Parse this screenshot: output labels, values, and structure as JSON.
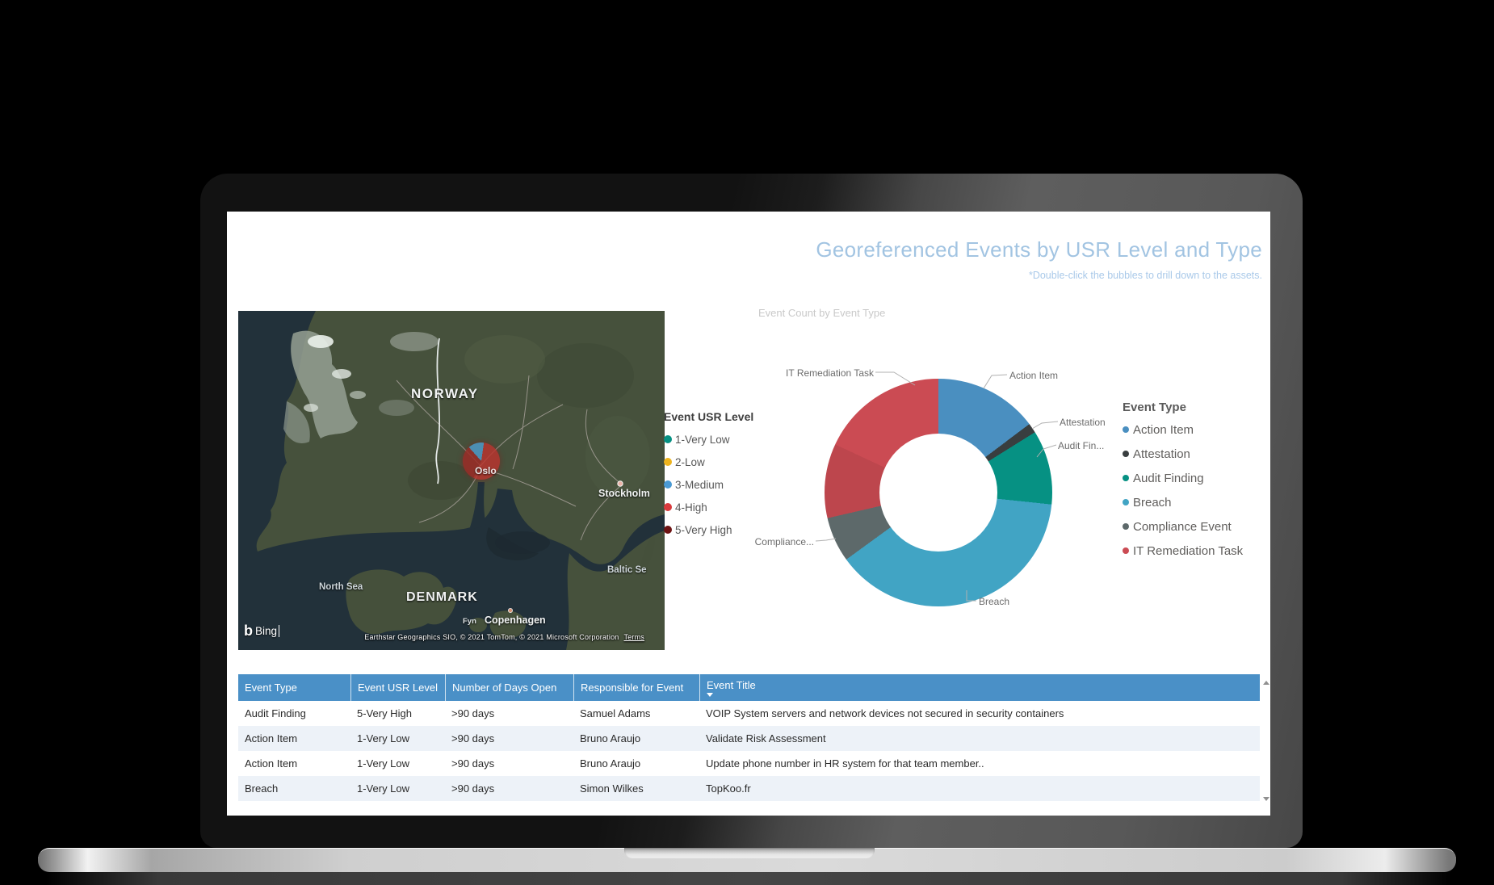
{
  "header": {
    "title": "Georeferenced Events by USR Level and Type",
    "subtitle": "*Double-click the bubbles to drill down to the assets.",
    "title_color": "#a2c4e2"
  },
  "map": {
    "logo": "Bing",
    "logo_glyph": "b",
    "attribution": "Earthstar Geographics SIO, © 2021 TomTom, © 2021 Microsoft Corporation",
    "terms_label": "Terms",
    "labels": {
      "norway": "NORWAY",
      "denmark": "DENMARK",
      "north_sea": "North Sea",
      "baltic_sea": "Baltic Se",
      "oslo": "Oslo",
      "stockholm": "Stockholm",
      "copenhagen": "Copenhagen",
      "fyn": "Fyn"
    }
  },
  "usr_legend": {
    "title": "Event USR Level",
    "items": [
      {
        "label": "1-Very Low",
        "color": "#069183"
      },
      {
        "label": "2-Low",
        "color": "#eeb41f"
      },
      {
        "label": "3-Medium",
        "color": "#4a9ad4"
      },
      {
        "label": "4-High",
        "color": "#d93a3c"
      },
      {
        "label": "5-Very High",
        "color": "#6e1414"
      }
    ]
  },
  "type_legend": {
    "title": "Event Type",
    "items": [
      {
        "label": "Action Item",
        "color": "#4a8fc0"
      },
      {
        "label": "Attestation",
        "color": "#393e3f"
      },
      {
        "label": "Audit Finding",
        "color": "#069183"
      },
      {
        "label": "Breach",
        "color": "#41a4c4"
      },
      {
        "label": "Compliance Event",
        "color": "#5d696a"
      },
      {
        "label": "IT Remediation Task",
        "color": "#cb4b53"
      }
    ]
  },
  "chart_data": [
    {
      "type": "pie",
      "subtype": "donut",
      "title": "Event Count by Event Type",
      "legend_position": "right",
      "series": [
        {
          "name": "Action Item",
          "angle_deg": 53,
          "approx_pct": 14.7,
          "color": "#4a8fc0"
        },
        {
          "name": "Attestation",
          "angle_deg": 5,
          "approx_pct": 1.4,
          "color": "#393e3f"
        },
        {
          "name": "Audit Finding",
          "angle_deg": 38,
          "approx_pct": 10.6,
          "color": "#069183"
        },
        {
          "name": "Breach",
          "angle_deg": 138,
          "approx_pct": 38.3,
          "color": "#41a4c4"
        },
        {
          "name": "Compliance Event",
          "angle_deg": 23,
          "approx_pct": 6.4,
          "color": "#5d696a"
        },
        {
          "name": "IT Remediation Task",
          "angle_deg": 103,
          "approx_pct": 28.6,
          "color": "#cb4b53"
        }
      ],
      "callouts": [
        "IT Remediation Task",
        "Action Item",
        "Attestation",
        "Audit Fin...",
        "Compliance...",
        "Breach"
      ]
    },
    {
      "type": "pie",
      "subtype": "map-bubble",
      "location": "Oslo",
      "legend": "Event USR Level",
      "start_angle_deg": -42,
      "series": [
        {
          "name": "3-Medium",
          "angle_deg": 50,
          "approx_pct": 13.9,
          "color": "#4d9bcd"
        },
        {
          "name": "4-High",
          "angle_deg": 310,
          "approx_pct": 86.1,
          "color": "#ba332d"
        }
      ]
    }
  ],
  "table": {
    "columns": [
      "Event Type",
      "Event USR Level",
      "Number of Days Open",
      "Responsible for Event",
      "Event Title"
    ],
    "sorted_column": "Event Title",
    "header_bg": "#4a90c7",
    "rows": [
      [
        "Audit Finding",
        "5-Very High",
        ">90 days",
        "Samuel Adams",
        "VOIP System servers and network devices not secured in security containers"
      ],
      [
        "Action Item",
        "1-Very Low",
        ">90 days",
        "Bruno Araujo",
        "Validate Risk Assessment"
      ],
      [
        "Action Item",
        "1-Very Low",
        ">90 days",
        "Bruno Araujo",
        "Update phone number in HR system for that team member.."
      ],
      [
        "Breach",
        "1-Very Low",
        ">90 days",
        "Simon Wilkes",
        "TopKoo.fr"
      ]
    ]
  }
}
